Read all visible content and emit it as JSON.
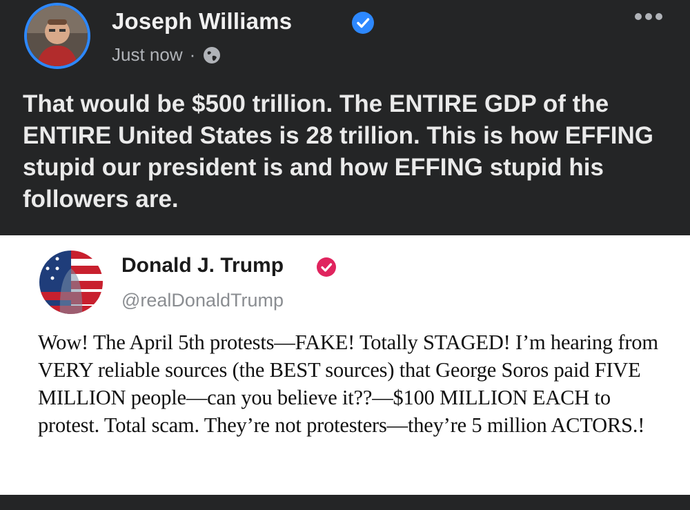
{
  "fb_post": {
    "author": "Joseph Williams",
    "time": "Just now",
    "separator": "·",
    "text": "That would be $500 trillion. The ENTIRE GDP of the ENTIRE United States is 28 trillion.  This is how EFFING stupid our president is and how EFFING stupid his followers are.",
    "icons": {
      "verified": "verified-badge-icon",
      "audience": "globe-icon",
      "more": "more-options-icon"
    },
    "colors": {
      "background": "#242526",
      "verified": "#2d88ff",
      "text": "#eaeaea"
    }
  },
  "tweet": {
    "name": "Donald J. Trump",
    "handle": "@realDonaldTrump",
    "text": "Wow! The April 5th protests—FAKE! Totally STAGED! I’m hearing from VERY reliable sources (the BEST sources) that George Soros paid FIVE MILLION people—can you believe it??—$100 MILLION EACH to protest. Total scam. They’re not protesters—they’re 5 million ACTORS.!",
    "icons": {
      "verified": "verified-badge-icon"
    },
    "colors": {
      "verified": "#e0245e",
      "background": "#ffffff"
    }
  }
}
